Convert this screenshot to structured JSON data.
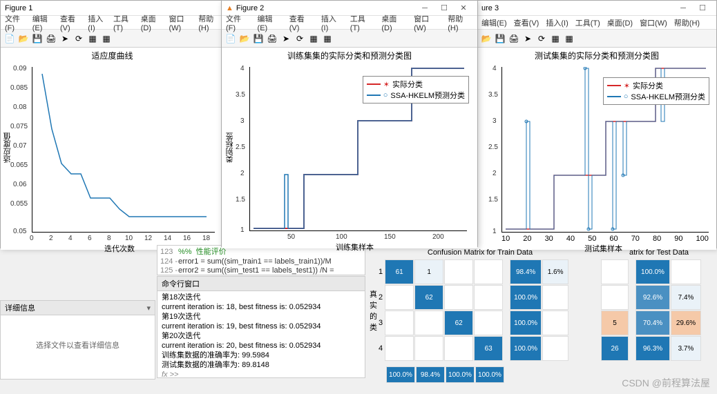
{
  "figure1": {
    "title": "Figure 1",
    "menus": [
      "文件(F)",
      "编辑(E)",
      "查看(V)",
      "插入(I)",
      "工具(T)",
      "桌面(D)",
      "窗口(W)",
      "帮助(H)"
    ],
    "chart_title": "适应度曲线",
    "ylabel": "适应度值",
    "xlabel": "迭代次数",
    "yticks": [
      "0.09",
      "0.085",
      "0.08",
      "0.075",
      "0.07",
      "0.065",
      "0.06",
      "0.055",
      "0.05"
    ],
    "xticks": [
      "0",
      "2",
      "4",
      "6",
      "8",
      "10",
      "12",
      "14",
      "16",
      "18"
    ],
    "yrange": [
      0.05,
      0.095
    ]
  },
  "figure2": {
    "title": "Figure 2",
    "menus": [
      "文件(F)",
      "编辑(E)",
      "查看(V)",
      "插入(I)",
      "工具(T)",
      "桌面(D)",
      "窗口(W)",
      "帮助(H)"
    ],
    "chart_title": "训练集集的实际分类和预测分类图",
    "ylabel": "类别标签",
    "xlabel": "训练集样本",
    "legend": [
      "实际分类",
      "SSA-HKELM预测分类"
    ],
    "yticks": [
      "4",
      "3.5",
      "3",
      "2.5",
      "2",
      "1.5",
      "1"
    ],
    "xticks": [
      "50",
      "100",
      "150",
      "200"
    ]
  },
  "figure3": {
    "title": "ure 3",
    "menus": [
      "编辑(E)",
      "查看(V)",
      "插入(I)",
      "工具(T)",
      "桌面(D)",
      "窗口(W)",
      "帮助(H)"
    ],
    "chart_title": "测试集集的实际分类和预测分类图",
    "ylabel": "类别标签",
    "xlabel": "测试集样本",
    "legend": [
      "实际分类",
      "SSA-HKELM预测分类"
    ],
    "yticks": [
      "4",
      "3.5",
      "3",
      "2.5",
      "2",
      "1.5",
      "1"
    ],
    "xticks": [
      "10",
      "20",
      "30",
      "40",
      "50",
      "60",
      "70",
      "80",
      "90",
      "100"
    ]
  },
  "code": {
    "lines": [
      {
        "n": "123",
        "t": "%%  性能评价"
      },
      {
        "n": "124 -",
        "t": "error1 = sum((sim_train1 == labels_train1))/M"
      },
      {
        "n": "125 -",
        "t": "error2 = sum((sim_test1 == labels_test1)) /N ="
      }
    ]
  },
  "cmd": {
    "title": "命令行窗口",
    "lines": [
      "第18次迭代",
      "current iteration is: 18, best fitness is: 0.052934",
      "第19次迭代",
      "current iteration is: 19, best fitness is: 0.052934",
      "第20次迭代",
      "current iteration is: 20, best fitness is: 0.052934",
      "训练集数据的准确率为: 99.5984",
      "测试集数据的准确率为: 89.8148"
    ],
    "prompt": "fx >>"
  },
  "detail": {
    "title": "详细信息",
    "msg": "选择文件以查看详细信息"
  },
  "conf_train": {
    "title": "Confusion Matrix for Train Data",
    "ylabel_chars": [
      "真",
      "实",
      "的",
      "类"
    ],
    "rows": [
      "1",
      "2",
      "3",
      "4"
    ],
    "data": [
      [
        "61",
        "1",
        "",
        ""
      ],
      [
        "",
        "62",
        "",
        ""
      ],
      [
        "",
        "",
        "62",
        ""
      ],
      [
        "",
        "",
        "",
        "63"
      ]
    ],
    "rowpct": [
      [
        "98.4%",
        "1.6%"
      ],
      [
        "100.0%",
        ""
      ],
      [
        "100.0%",
        ""
      ],
      [
        "100.0%",
        ""
      ]
    ],
    "colpct": [
      "100.0%",
      "98.4%",
      "100.0%",
      "100.0%"
    ]
  },
  "conf_test": {
    "title": "atrix for Test Data",
    "col": [
      [
        "100.0%",
        ""
      ],
      [
        "92.6%",
        "7.4%"
      ],
      [
        "70.4%",
        "29.6%"
      ],
      [
        "96.3%",
        "3.7%"
      ]
    ],
    "extra": [
      "5",
      "26"
    ]
  },
  "watermark": "CSDN @前程算法屋",
  "chart_data": [
    {
      "type": "line",
      "title": "适应度曲线",
      "xlabel": "迭代次数",
      "ylabel": "适应度值",
      "xlim": [
        0,
        18
      ],
      "ylim": [
        0.05,
        0.095
      ],
      "x": [
        1,
        2,
        3,
        4,
        5,
        6,
        7,
        8,
        9,
        10,
        11,
        12,
        13,
        14,
        15,
        16,
        17,
        18
      ],
      "y": [
        0.092,
        0.077,
        0.068,
        0.065,
        0.065,
        0.058,
        0.058,
        0.058,
        0.055,
        0.053,
        0.053,
        0.053,
        0.053,
        0.053,
        0.053,
        0.053,
        0.053,
        0.053
      ]
    },
    {
      "type": "line",
      "title": "训练集集的实际分类和预测分类图",
      "xlabel": "训练集样本",
      "ylabel": "类别标签",
      "xlim": [
        0,
        250
      ],
      "ylim": [
        1,
        4
      ],
      "legend": [
        "实际分类",
        "SSA-HKELM预测分类"
      ],
      "series": [
        {
          "name": "实际分类",
          "pattern": "step 1→2→3→4 at x≈62,125,187"
        },
        {
          "name": "SSA-HKELM预测分类",
          "pattern": "step matching actual with spike to 2 at x≈42"
        }
      ]
    },
    {
      "type": "line",
      "title": "测试集集的实际分类和预测分类图",
      "xlabel": "测试集样本",
      "ylabel": "类别标签",
      "xlim": [
        0,
        108
      ],
      "ylim": [
        1,
        4
      ],
      "legend": [
        "实际分类",
        "SSA-HKELM预测分类"
      ],
      "series": [
        {
          "name": "实际分类",
          "pattern": "step 1→2→3→4 at x≈27,54,80"
        },
        {
          "name": "SSA-HKELM预测分类",
          "pattern": "noisy step with misclassifications around transitions"
        }
      ]
    },
    {
      "type": "heatmap",
      "title": "Confusion Matrix for Train Data",
      "categories": [
        "1",
        "2",
        "3",
        "4"
      ],
      "matrix": [
        [
          61,
          1,
          0,
          0
        ],
        [
          0,
          62,
          0,
          0
        ],
        [
          0,
          0,
          62,
          0
        ],
        [
          0,
          0,
          0,
          63
        ]
      ],
      "row_pct": [
        [
          98.4,
          1.6
        ],
        [
          100.0,
          0
        ],
        [
          100.0,
          0
        ],
        [
          100.0,
          0
        ]
      ],
      "col_pct": [
        100.0,
        98.4,
        100.0,
        100.0
      ]
    },
    {
      "type": "heatmap",
      "title": "Confusion Matrix for Test Data (partial)",
      "row_pct": [
        [
          100.0,
          0
        ],
        [
          92.6,
          7.4
        ],
        [
          70.4,
          29.6
        ],
        [
          96.3,
          3.7
        ]
      ]
    }
  ]
}
